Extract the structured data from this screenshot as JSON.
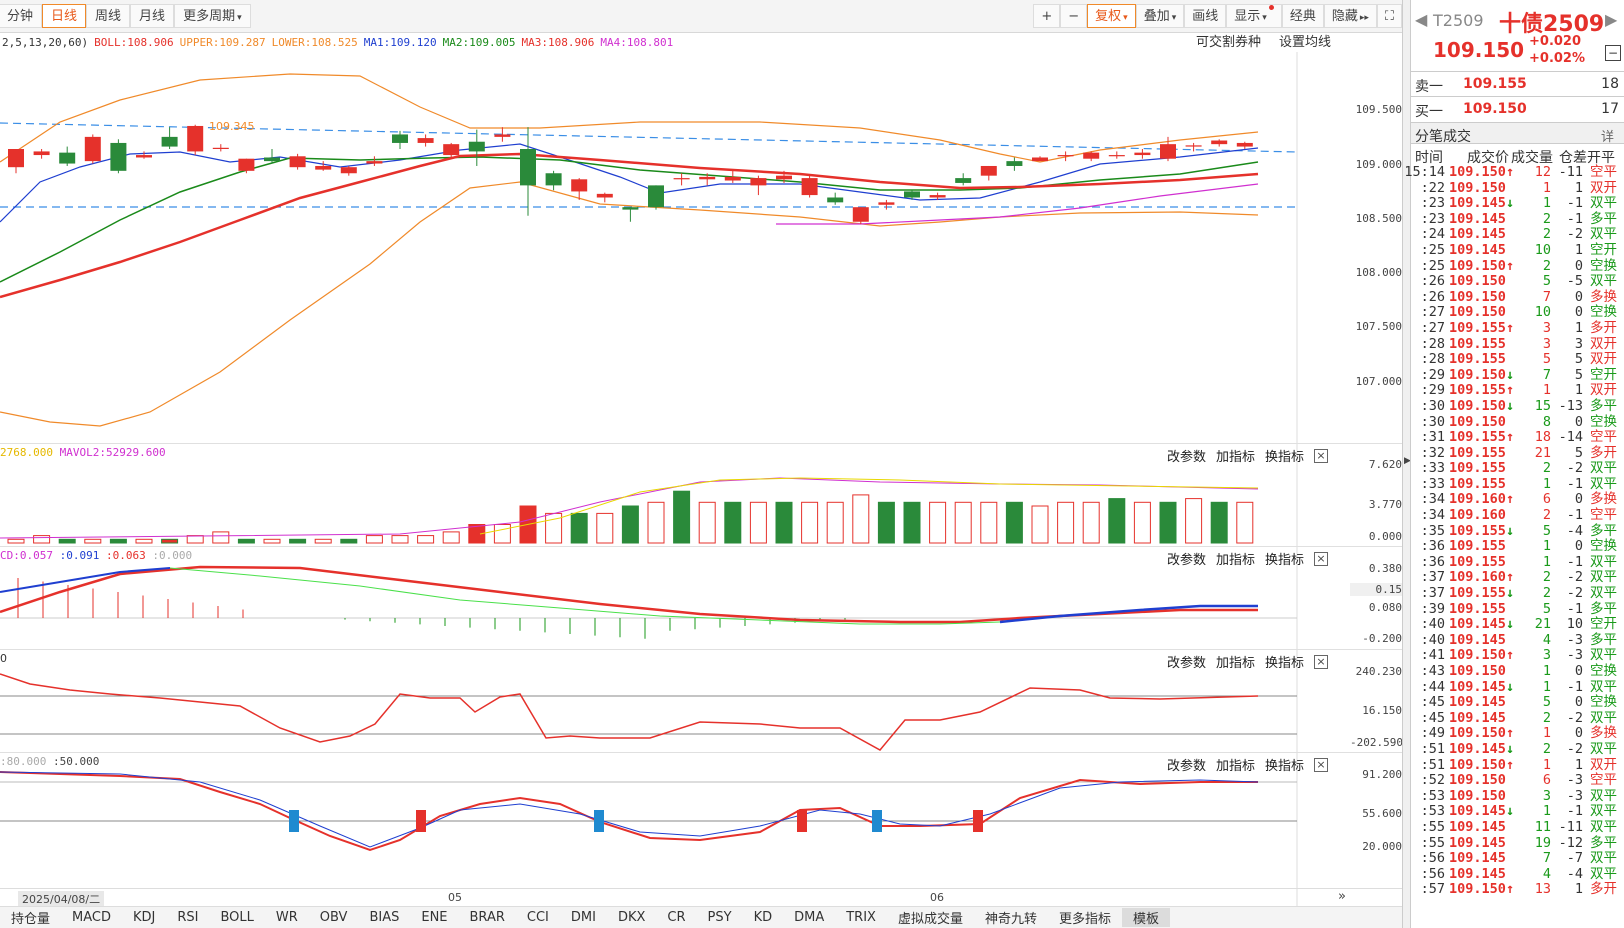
{
  "toolbar": {
    "tabs": [
      "分钟",
      "日线",
      "周线",
      "月线",
      "更多周期"
    ],
    "active": 1,
    "right": [
      "+",
      "−",
      "复权",
      "叠加",
      "画线",
      "显示",
      "经典",
      "隐藏"
    ]
  },
  "indicator_line": {
    "params": "2,5,13,20,60)",
    "boll": "BOLL:108.906",
    "upper": "UPPER:109.287",
    "lower": "LOWER:108.525",
    "ma1": "MA1:109.120",
    "ma2": "MA2:109.005",
    "ma3": "MA3:108.906",
    "ma4": "MA4:108.801"
  },
  "top_links": {
    "a": "可交割券种",
    "b": "设置均线"
  },
  "panel_ctrl": {
    "a": "改参数",
    "b": "加指标",
    "c": "换指标",
    "x": "×"
  },
  "price_labels": [
    "109.500",
    "109.000",
    "108.500",
    "108.000",
    "107.500",
    "107.000"
  ],
  "high_marker": "109.345",
  "vol": {
    "vol": "2768.000",
    "mavol2": "MAVOL2:52929.600",
    "labels": [
      "7.620",
      "3.770",
      "0.000"
    ]
  },
  "macd": {
    "a": "CD:0.057",
    "b": ":0.091",
    "c": ":0.063",
    "d": ":0.000",
    "labels": [
      "0.380",
      "0.15",
      "0.080",
      "-0.200"
    ]
  },
  "cci": {
    "a": "0",
    "labels": [
      "240.230",
      "16.150",
      "-202.590"
    ]
  },
  "kdj": {
    "a": ":80.000",
    "b": ":50.000",
    "labels": [
      "91.200",
      "55.600",
      "20.000"
    ]
  },
  "dates": {
    "d1": "2025/04/08/二",
    "d2": "05",
    "d3": "06"
  },
  "bottom_tabs": [
    "持仓量",
    "MACD",
    "KDJ",
    "RSI",
    "BOLL",
    "WR",
    "OBV",
    "BIAS",
    "ENE",
    "BRAR",
    "CCI",
    "DMI",
    "DKX",
    "CR",
    "PSY",
    "KD",
    "DMA",
    "TRIX",
    "虚拟成交量",
    "神奇九转",
    "更多指标",
    "模板"
  ],
  "right": {
    "code": "T2509",
    "name": "十债2509",
    "price": "109.150",
    "chg": "+0.020",
    "pct": "+0.02%",
    "sell_label": "卖一",
    "sell_price": "109.155",
    "sell_vol": "18",
    "buy_label": "买一",
    "buy_price": "109.150",
    "buy_vol": "17",
    "ticks_title": "分笔成交",
    "detail": "详",
    "headers": [
      "时间",
      "成交价",
      "成交量",
      "仓差",
      "开平"
    ]
  },
  "ticks": [
    [
      "15:14",
      "109.150",
      "↑",
      "12",
      "-11",
      "空平",
      "r"
    ],
    [
      ":22",
      "109.150",
      "",
      "1",
      "1",
      "双开",
      "r"
    ],
    [
      ":23",
      "109.145",
      "↓",
      "1",
      "-1",
      "双平",
      "g"
    ],
    [
      ":23",
      "109.145",
      "",
      "2",
      "-1",
      "多平",
      "g"
    ],
    [
      ":24",
      "109.145",
      "",
      "2",
      "-2",
      "双平",
      "g"
    ],
    [
      ":25",
      "109.145",
      "",
      "10",
      "1",
      "空开",
      "g"
    ],
    [
      ":25",
      "109.150",
      "↑",
      "2",
      "0",
      "空换",
      "g"
    ],
    [
      ":26",
      "109.150",
      "",
      "5",
      "-5",
      "双平",
      "g"
    ],
    [
      ":26",
      "109.150",
      "",
      "7",
      "0",
      "多换",
      "r"
    ],
    [
      ":27",
      "109.150",
      "",
      "10",
      "0",
      "空换",
      "g"
    ],
    [
      ":27",
      "109.155",
      "↑",
      "3",
      "1",
      "多开",
      "r"
    ],
    [
      ":28",
      "109.155",
      "",
      "3",
      "3",
      "双开",
      "r"
    ],
    [
      ":28",
      "109.155",
      "",
      "5",
      "5",
      "双开",
      "r"
    ],
    [
      ":29",
      "109.150",
      "↓",
      "7",
      "5",
      "空开",
      "g"
    ],
    [
      ":29",
      "109.155",
      "↑",
      "1",
      "1",
      "双开",
      "r"
    ],
    [
      ":30",
      "109.150",
      "↓",
      "15",
      "-13",
      "多平",
      "g"
    ],
    [
      ":30",
      "109.150",
      "",
      "8",
      "0",
      "空换",
      "g"
    ],
    [
      ":31",
      "109.155",
      "↑",
      "18",
      "-14",
      "空平",
      "r"
    ],
    [
      ":32",
      "109.155",
      "",
      "21",
      "5",
      "多开",
      "r"
    ],
    [
      ":33",
      "109.155",
      "",
      "2",
      "-2",
      "双平",
      "g"
    ],
    [
      ":33",
      "109.155",
      "",
      "1",
      "-1",
      "双平",
      "g"
    ],
    [
      ":34",
      "109.160",
      "↑",
      "6",
      "0",
      "多换",
      "r"
    ],
    [
      ":34",
      "109.160",
      "",
      "2",
      "-1",
      "空平",
      "r"
    ],
    [
      ":35",
      "109.155",
      "↓",
      "5",
      "-4",
      "多平",
      "g"
    ],
    [
      ":36",
      "109.155",
      "",
      "1",
      "0",
      "空换",
      "g"
    ],
    [
      ":36",
      "109.155",
      "",
      "1",
      "-1",
      "双平",
      "g"
    ],
    [
      ":37",
      "109.160",
      "↑",
      "2",
      "-2",
      "双平",
      "g"
    ],
    [
      ":37",
      "109.155",
      "↓",
      "2",
      "-2",
      "双平",
      "g"
    ],
    [
      ":39",
      "109.155",
      "",
      "5",
      "-1",
      "多平",
      "g"
    ],
    [
      ":40",
      "109.145",
      "↓",
      "21",
      "10",
      "空开",
      "g"
    ],
    [
      ":40",
      "109.145",
      "",
      "4",
      "-3",
      "多平",
      "g"
    ],
    [
      ":41",
      "109.150",
      "↑",
      "3",
      "-3",
      "双平",
      "g"
    ],
    [
      ":43",
      "109.150",
      "",
      "1",
      "0",
      "空换",
      "g"
    ],
    [
      ":44",
      "109.145",
      "↓",
      "1",
      "-1",
      "双平",
      "g"
    ],
    [
      ":45",
      "109.145",
      "",
      "5",
      "0",
      "空换",
      "g"
    ],
    [
      ":45",
      "109.145",
      "",
      "2",
      "-2",
      "双平",
      "g"
    ],
    [
      ":49",
      "109.150",
      "↑",
      "1",
      "0",
      "多换",
      "r"
    ],
    [
      ":51",
      "109.145",
      "↓",
      "2",
      "-2",
      "双平",
      "g"
    ],
    [
      ":51",
      "109.150",
      "↑",
      "1",
      "1",
      "双开",
      "r"
    ],
    [
      ":52",
      "109.150",
      "",
      "6",
      "-3",
      "空平",
      "r"
    ],
    [
      ":53",
      "109.150",
      "",
      "3",
      "-3",
      "双平",
      "g"
    ],
    [
      ":53",
      "109.145",
      "↓",
      "1",
      "-1",
      "双平",
      "g"
    ],
    [
      ":55",
      "109.145",
      "",
      "11",
      "-11",
      "双平",
      "g"
    ],
    [
      ":55",
      "109.145",
      "",
      "19",
      "-12",
      "多平",
      "g"
    ],
    [
      ":56",
      "109.145",
      "",
      "7",
      "-7",
      "双平",
      "g"
    ],
    [
      ":56",
      "109.145",
      "",
      "4",
      "-4",
      "双平",
      "g"
    ],
    [
      ":57",
      "109.150",
      "↑",
      "13",
      "1",
      "多开",
      "r"
    ]
  ],
  "chart_data": {
    "type": "candlestick",
    "ylim": [
      106.7,
      109.9
    ],
    "candles": [
      [
        108.95,
        109.1,
        108.9,
        109.1
      ],
      [
        109.05,
        109.1,
        109.02,
        109.08
      ],
      [
        109.07,
        109.12,
        108.96,
        108.98
      ],
      [
        109.0,
        109.22,
        108.98,
        109.2
      ],
      [
        109.15,
        109.18,
        108.9,
        108.92
      ],
      [
        109.03,
        109.08,
        109.02,
        109.05
      ],
      [
        109.2,
        109.28,
        109.1,
        109.12
      ],
      [
        109.08,
        109.3,
        109.05,
        109.29
      ],
      [
        109.1,
        109.14,
        109.08,
        109.11
      ],
      [
        108.92,
        109.02,
        108.9,
        109.02
      ],
      [
        109.03,
        109.1,
        108.98,
        109.0
      ],
      [
        108.95,
        109.06,
        108.93,
        109.04
      ],
      [
        108.93,
        109.0,
        108.92,
        108.96
      ],
      [
        108.9,
        108.96,
        108.88,
        108.95
      ],
      [
        108.98,
        109.04,
        108.96,
        109.0
      ],
      [
        109.22,
        109.25,
        109.1,
        109.15
      ],
      [
        109.15,
        109.22,
        109.12,
        109.19
      ],
      [
        109.05,
        109.15,
        109.02,
        109.14
      ],
      [
        109.16,
        109.26,
        108.96,
        109.08
      ],
      [
        109.2,
        109.28,
        109.16,
        109.22
      ],
      [
        109.1,
        109.28,
        108.55,
        108.8
      ],
      [
        108.9,
        108.92,
        108.76,
        108.8
      ],
      [
        108.75,
        108.86,
        108.68,
        108.85
      ],
      [
        108.7,
        108.74,
        108.66,
        108.73
      ],
      [
        108.62,
        108.62,
        108.5,
        108.6
      ],
      [
        108.8,
        108.8,
        108.6,
        108.62
      ],
      [
        108.85,
        108.9,
        108.8,
        108.86
      ],
      [
        108.85,
        108.9,
        108.8,
        108.87
      ],
      [
        108.84,
        108.92,
        108.82,
        108.87
      ],
      [
        108.8,
        108.88,
        108.72,
        108.86
      ],
      [
        108.85,
        108.92,
        108.82,
        108.88
      ],
      [
        108.72,
        108.88,
        108.7,
        108.86
      ],
      [
        108.7,
        108.74,
        108.64,
        108.66
      ],
      [
        108.5,
        108.62,
        108.48,
        108.62
      ],
      [
        108.64,
        108.68,
        108.6,
        108.66
      ],
      [
        108.75,
        108.76,
        108.68,
        108.7
      ],
      [
        108.7,
        108.74,
        108.68,
        108.72
      ],
      [
        108.86,
        108.9,
        108.8,
        108.82
      ],
      [
        108.88,
        108.96,
        108.84,
        108.96
      ],
      [
        109.0,
        109.03,
        108.92,
        108.96
      ],
      [
        109.0,
        109.04,
        109.0,
        109.03
      ],
      [
        109.04,
        109.08,
        109.0,
        109.05
      ],
      [
        109.02,
        109.08,
        109.0,
        109.07
      ],
      [
        109.04,
        109.08,
        109.02,
        109.05
      ],
      [
        109.05,
        109.1,
        109.02,
        109.07
      ],
      [
        109.02,
        109.2,
        109.0,
        109.14
      ],
      [
        109.12,
        109.15,
        109.08,
        109.13
      ],
      [
        109.14,
        109.18,
        109.12,
        109.17
      ],
      [
        109.12,
        109.16,
        109.1,
        109.15
      ]
    ]
  }
}
